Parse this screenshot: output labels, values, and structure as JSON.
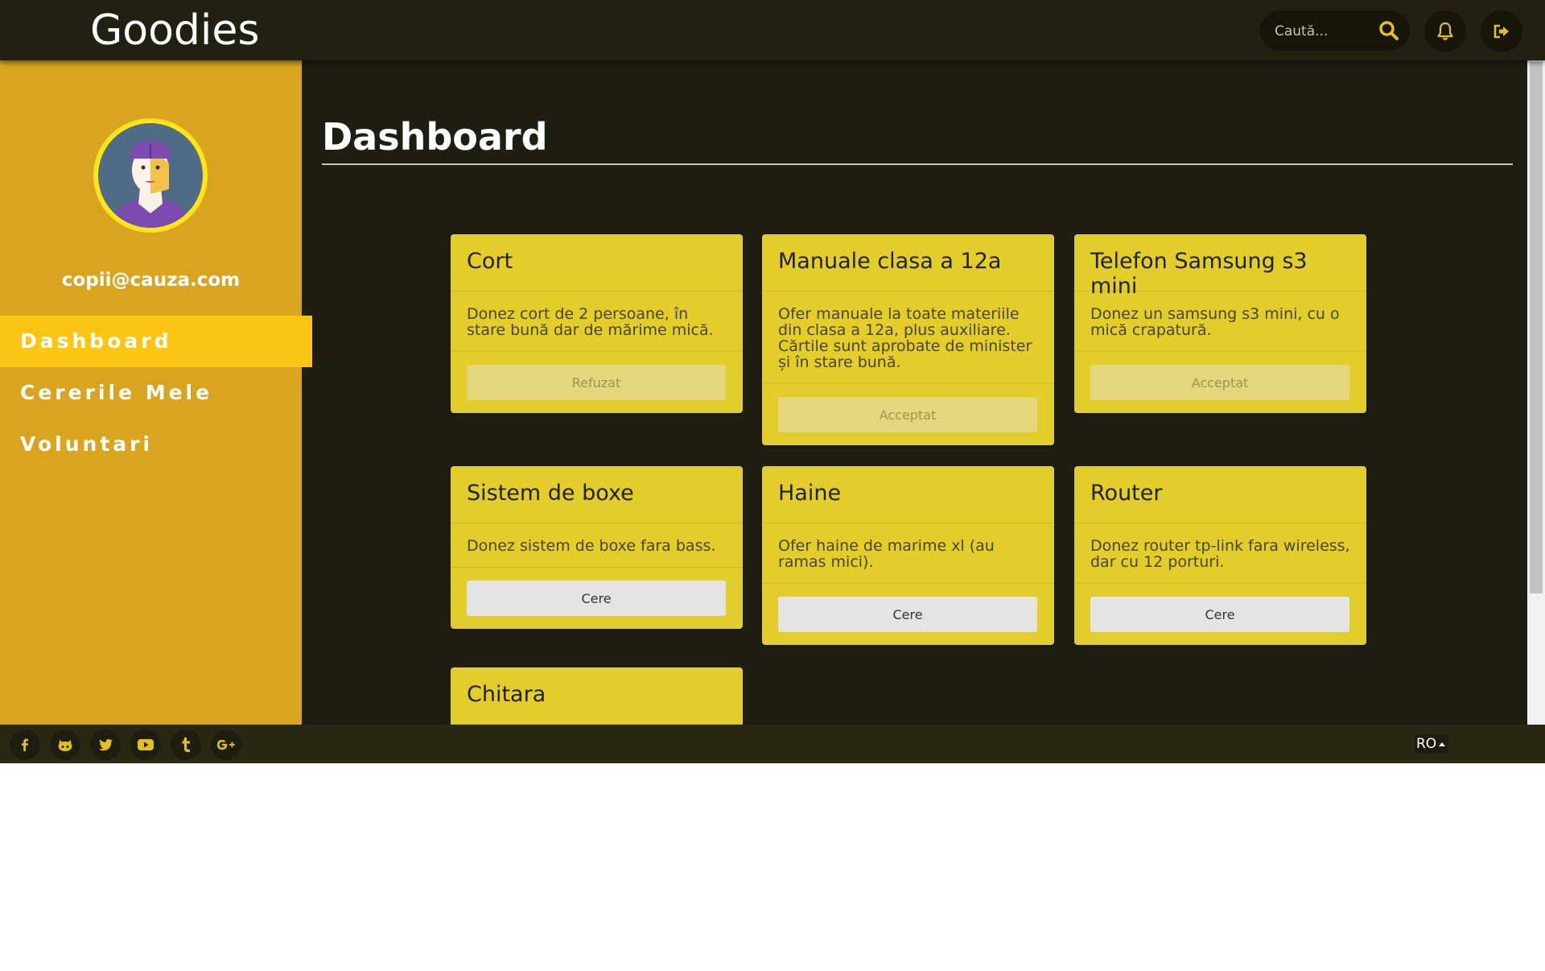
{
  "header": {
    "brand": "Goodies",
    "search_placeholder": "Caută..."
  },
  "sidebar": {
    "user_email": "copii@cauza.com",
    "items": [
      {
        "label": "Dashboard",
        "active": true
      },
      {
        "label": "Cererile Mele",
        "active": false
      },
      {
        "label": "Voluntari",
        "active": false
      }
    ]
  },
  "main": {
    "title": "Dashboard",
    "cards": [
      {
        "title": "Cort",
        "description": "Donez cort de 2 persoane, în stare bună dar de mărime mică.",
        "button": "Refuzat",
        "disabled": true
      },
      {
        "title": "Manuale clasa a 12a",
        "description": "Ofer manuale la toate materiile din clasa a 12a, plus auxiliare. Cărtile sunt aprobate de minister și în stare bună.",
        "button": "Acceptat",
        "disabled": true
      },
      {
        "title": "Telefon Samsung s3 mini",
        "description": "Donez un samsung s3 mini, cu o mică crapatură.",
        "button": "Acceptat",
        "disabled": true
      },
      {
        "title": "Sistem de boxe",
        "description": "Donez sistem de boxe fara bass.",
        "button": "Cere",
        "disabled": false
      },
      {
        "title": "Haine",
        "description": "Ofer haine de marime xl (au ramas mici).",
        "button": "Cere",
        "disabled": false
      },
      {
        "title": "Router",
        "description": "Donez router tp-link fara wireless, dar cu 12 porturi.",
        "button": "Cere",
        "disabled": false
      },
      {
        "title": "Chitara",
        "description": "",
        "button": "",
        "disabled": false
      }
    ]
  },
  "footer": {
    "social_icons": [
      "facebook-icon",
      "github-icon",
      "twitter-icon",
      "youtube-icon",
      "tumblr-icon",
      "google-plus-icon"
    ],
    "language": "RO"
  },
  "colors": {
    "accent": "#fdc513",
    "sidebar": "#d9a520",
    "card": "#e3cd2b",
    "background": "#1f1e12"
  }
}
